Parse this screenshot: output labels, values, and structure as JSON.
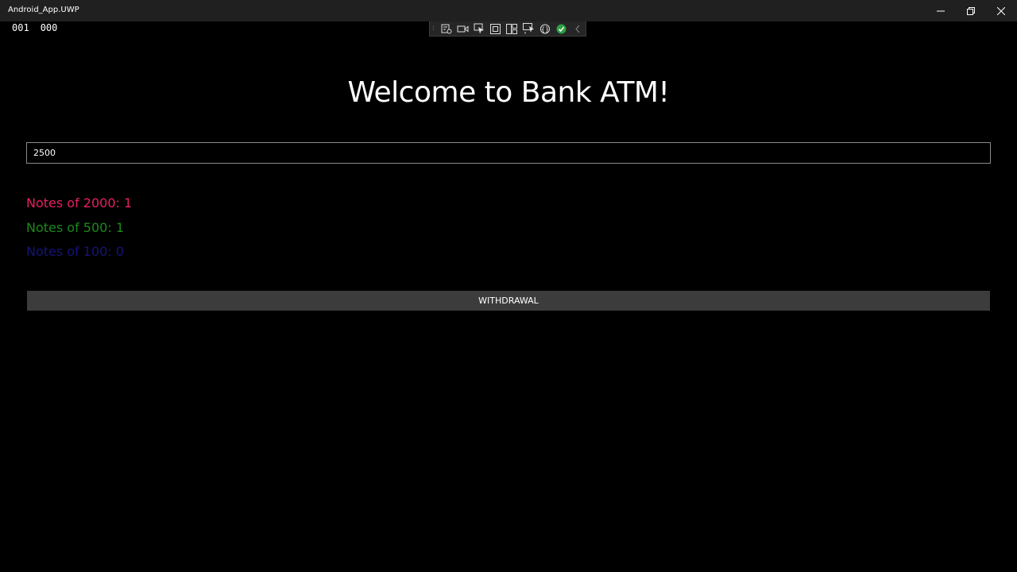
{
  "window": {
    "title": "Android_App.UWP",
    "controls": [
      "minimize-icon",
      "restore-icon",
      "close-icon"
    ]
  },
  "frame_counters": {
    "left": "001",
    "right": "000"
  },
  "debug_toolbar": {
    "icons": [
      "live-visual-tree-icon",
      "video-icon",
      "select-element-icon",
      "display-layout-adorners-icon",
      "track-focus-icon",
      "hot-reload-icon",
      "binding-failures-icon",
      "status-ok-icon",
      "collapse-chevron-icon"
    ]
  },
  "main": {
    "heading": "Welcome to Bank ATM!",
    "amount_value": "2500",
    "notes_2000": "Notes of 2000: 1",
    "notes_500": "Notes of 500: 1",
    "notes_100": "Notes of 100: 0",
    "withdraw_label": "WITHDRAWAL"
  },
  "colors": {
    "background": "#000000",
    "titlebar": "#202020",
    "notes_2000": "#e91e63",
    "notes_500": "#1b8a1b",
    "notes_100": "#14147a",
    "button": "#3c3c3c"
  }
}
